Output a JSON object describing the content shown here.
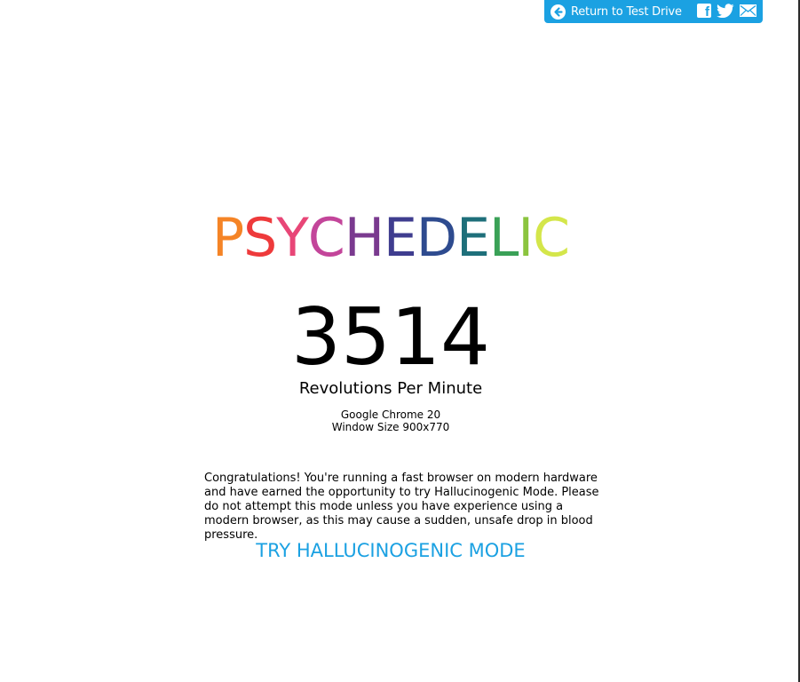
{
  "topbar": {
    "return_label": "Return to Test Drive",
    "icons": [
      "back-arrow-icon",
      "facebook-icon",
      "twitter-icon",
      "mail-icon"
    ],
    "facebook_glyph": "f",
    "background_color": "#1ba1e2"
  },
  "title": {
    "letters": [
      {
        "char": "P",
        "color": "#f58426"
      },
      {
        "char": "S",
        "color": "#ee3a3b"
      },
      {
        "char": "Y",
        "color": "#e84677"
      },
      {
        "char": "C",
        "color": "#c3459a"
      },
      {
        "char": "H",
        "color": "#7a3a8f"
      },
      {
        "char": "E",
        "color": "#3f3d8f"
      },
      {
        "char": "D",
        "color": "#2e4b8f"
      },
      {
        "char": "E",
        "color": "#1e6f7a"
      },
      {
        "char": "L",
        "color": "#3aa157"
      },
      {
        "char": "I",
        "color": "#8bc43f"
      },
      {
        "char": "C",
        "color": "#d4e64a"
      }
    ]
  },
  "rpm": {
    "value": "3514",
    "label": "Revolutions Per Minute"
  },
  "browser": {
    "name": "Google Chrome 20",
    "window_size": "Window Size 900x770"
  },
  "message": {
    "text": "Congratulations! You're running a fast browser on modern hardware and have earned the opportunity to try Hallucinogenic Mode. Please do not attempt this mode unless you have experience using a modern browser, as this may cause a sudden, unsafe drop in blood pressure."
  },
  "cta": {
    "label": "TRY HALLUCINOGENIC MODE",
    "color": "#1ba1e2"
  }
}
